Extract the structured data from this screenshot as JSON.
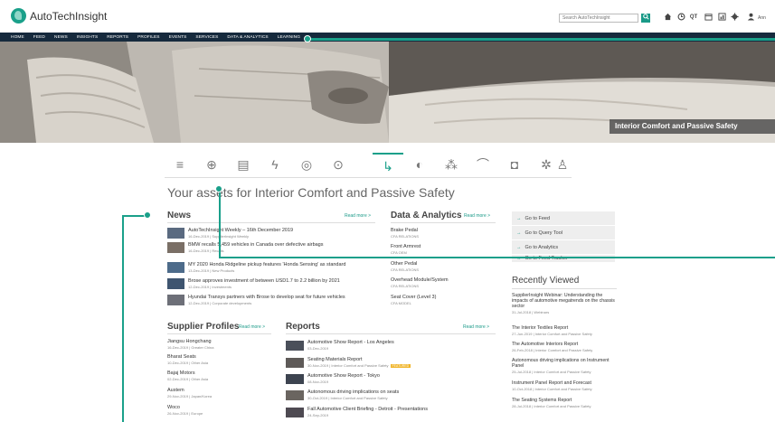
{
  "topbar": {
    "logo_text": "AutoTechInsight",
    "search_placeholder": "Search AutoTechInsight",
    "qt_label": "QT",
    "user_name": "Ann"
  },
  "nav": {
    "items": [
      "HOME",
      "FEED",
      "NEWS",
      "INSIGHTS",
      "REPORTS",
      "PROFILES",
      "EVENTS",
      "SERVICES",
      "DATA & ANALYTICS",
      "LEARNING"
    ]
  },
  "hero": {
    "caption": "Interior Comfort and Passive Safety"
  },
  "page_title": "Your assets for Interior Comfort and Passive Safety",
  "news": {
    "heading": "News",
    "read_more": "Read more >",
    "items": [
      {
        "title": "AutoTechInsight Weekly – 16th December 2019",
        "meta": "16-Dec-2019 | SupplierInsight Weekly"
      },
      {
        "title": "BMW recalls 5,459 vehicles in Canada over defective airbags",
        "meta": "16-Dec-2019 | Recalls"
      },
      {
        "title": "MY 2020 Honda Ridgeline pickup features 'Honda Sensing' as standard",
        "meta": "13-Dec-2019 | New Products"
      },
      {
        "title": "Brose approves investment of between USD1.7 to 2.2 billion by 2021",
        "meta": "12-Dec-2019 | Investments"
      },
      {
        "title": "Hyundai Transys partners with Brose to develop seat for future vehicles",
        "meta": "12-Dec-2019 | Corporate developments"
      }
    ]
  },
  "data_analytics": {
    "heading": "Data & Analytics",
    "read_more": "Read more >",
    "items": [
      {
        "title": "Brake Pedal",
        "meta": "CFA RELATIONS"
      },
      {
        "title": "Front Armrest",
        "meta": "CFA OEM"
      },
      {
        "title": "Other Pedal",
        "meta": "CFA RELATIONS"
      },
      {
        "title": "Overhead Module/System",
        "meta": "CFA RELATIONS"
      },
      {
        "title": "Seat Cover (Level 3)",
        "meta": "CFA MODEL"
      }
    ]
  },
  "go_links": [
    {
      "label": "Go to Feed"
    },
    {
      "label": "Go to Query Tool"
    },
    {
      "label": "Go to Analytics"
    },
    {
      "label": "Go to Feed Tracker"
    }
  ],
  "recently_viewed": {
    "heading": "Recently Viewed",
    "items": [
      {
        "title": "SupplierInsight Webinar: Understanding the impacts of automotive megatrends on the chassis sector",
        "meta": "31-Jul-2018 | Webinars"
      },
      {
        "title": "The Interior Textiles Report",
        "meta": "27-Jun-2019 | Interior Comfort and Passive Safety"
      },
      {
        "title": "The Automotive Interiors Report",
        "meta": "26-Feb-2018 | Interior Comfort and Passive Safety"
      },
      {
        "title": "Autonomous driving implications on Instrument Panel",
        "meta": "25-Jul-2018 | Interior Comfort and Passive Safety"
      },
      {
        "title": "Instrument Panel Report and Forecast",
        "meta": "10-Oct-2018 | Interior Comfort and Passive Safety"
      },
      {
        "title": "The Seating Systems Report",
        "meta": "28-Jul-2018 | Interior Comfort and Passive Safety"
      }
    ]
  },
  "supplier_profiles": {
    "heading": "Supplier Profiles",
    "read_more": "Read more >",
    "items": [
      {
        "title": "Jiangsu Hongchang",
        "meta": "16-Dec-2019 | Greater China"
      },
      {
        "title": "Bharat Seats",
        "meta": "10-Dec-2019 | Other Asia"
      },
      {
        "title": "Bajaj Motors",
        "meta": "02-Dec-2019 | Other Asia"
      },
      {
        "title": "Austem",
        "meta": "29-Nov-2019 | Japan/Korea"
      },
      {
        "title": "Woco",
        "meta": "26-Nov-2019 | Europe"
      }
    ]
  },
  "reports": {
    "heading": "Reports",
    "read_more": "Read more >",
    "items": [
      {
        "title": "Automotive Show Report - Los Angeles",
        "meta": "03-Dec-2019",
        "badge": ""
      },
      {
        "title": "Seating Materials Report",
        "meta": "30-Nov-2019 | Interior Comfort and Passive Safety",
        "badge": "FEATURED"
      },
      {
        "title": "Automotive Show Report - Tokyo",
        "meta": "08-Nov-2019",
        "badge": ""
      },
      {
        "title": "Autonomous driving implications on seats",
        "meta": "30-Oct-2019 | Interior Comfort and Passive Safety",
        "badge": ""
      },
      {
        "title": "Fall Automotive Client Briefing - Detroit - Presentations",
        "meta": "24-Sep-2019",
        "badge": ""
      }
    ]
  },
  "colors": {
    "accent": "#1aa08a",
    "nav_bg": "#162a3d",
    "badge": "#f0b428"
  },
  "category_icons": [
    "powertrain-icon",
    "chassis-icon",
    "battery-icon",
    "electrification-icon",
    "connectivity-icon",
    "safety-icon",
    "seat-icon",
    "lighting-icon",
    "molecule-icon",
    "wiper-icon",
    "engine-icon",
    "climate-icon",
    "person-icon"
  ]
}
